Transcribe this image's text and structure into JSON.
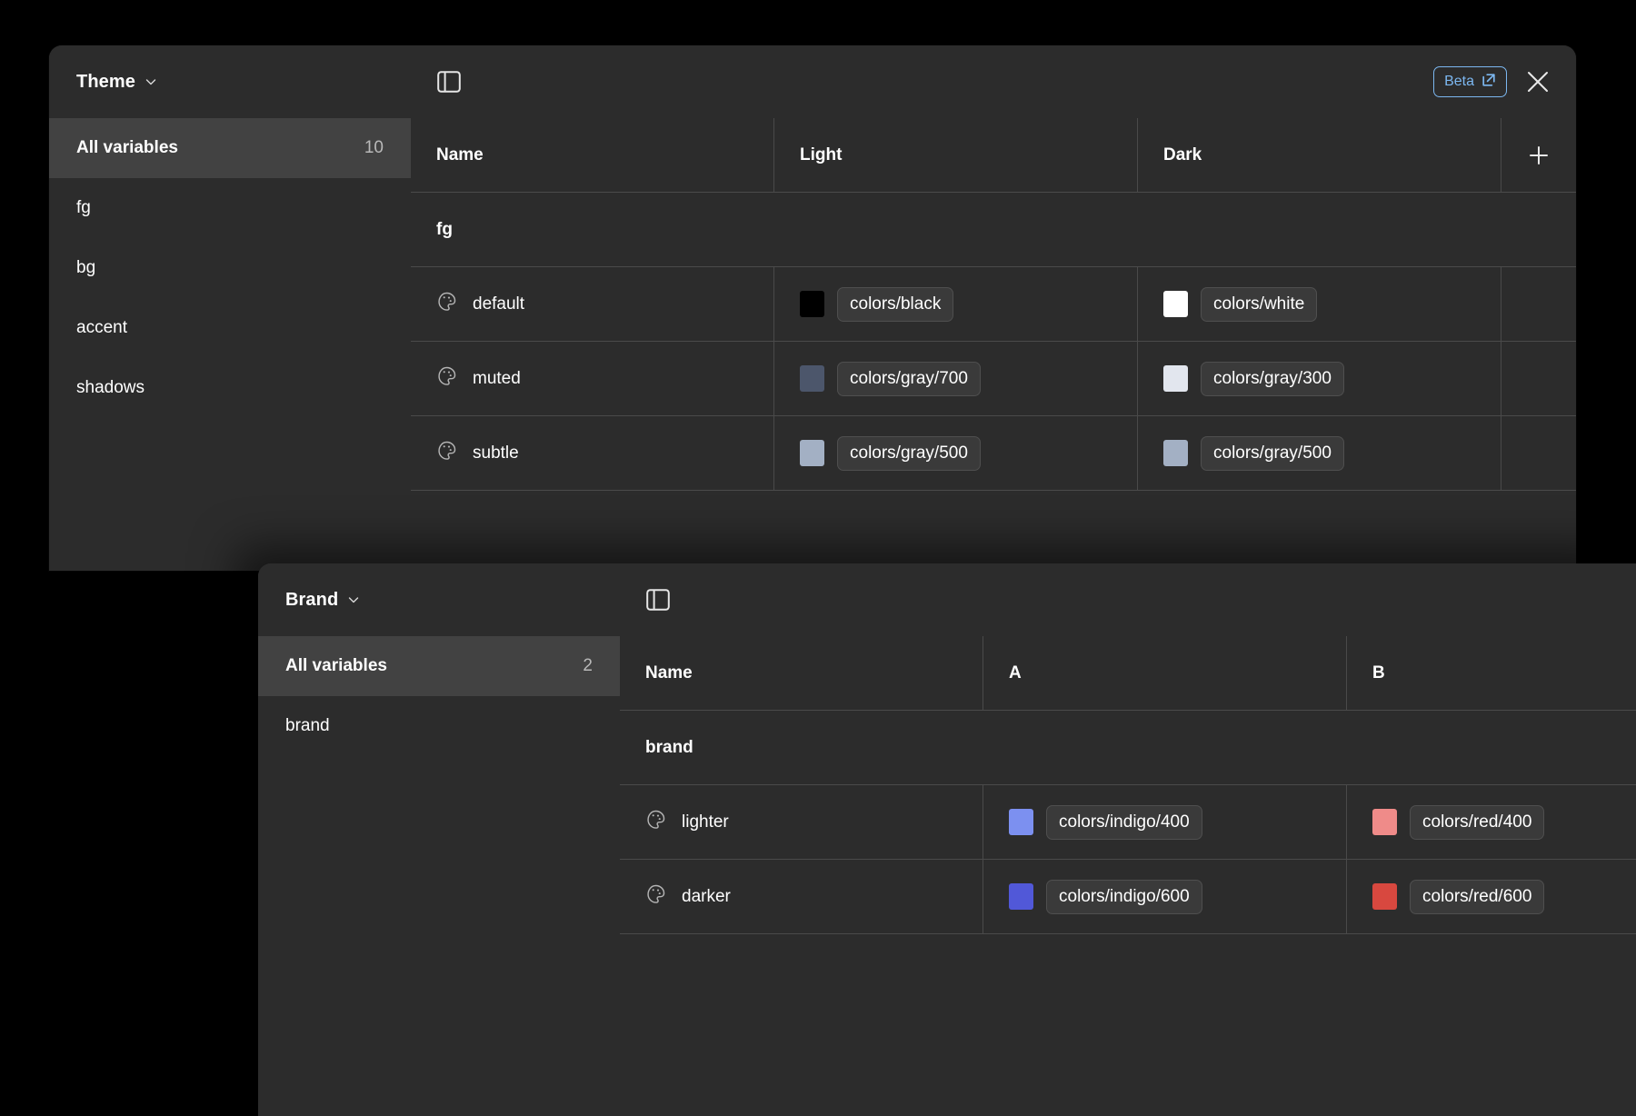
{
  "panels": [
    {
      "id": "theme",
      "collection_name": "Theme",
      "chevron_icon": "chevron-down-icon",
      "panel_toggle_icon": "panel-layout-icon",
      "beta_label": "Beta",
      "beta_external_icon": "external-link-icon",
      "close_icon": "close-icon",
      "add_icon": "plus-icon",
      "sidebar": {
        "all_label": "All variables",
        "all_count": "10",
        "groups": [
          {
            "label": "fg"
          },
          {
            "label": "bg"
          },
          {
            "label": "accent"
          },
          {
            "label": "shadows"
          }
        ]
      },
      "columns": [
        {
          "key": "name",
          "label": "Name"
        },
        {
          "key": "light",
          "label": "Light"
        },
        {
          "key": "dark",
          "label": "Dark"
        }
      ],
      "group_header": "fg",
      "rows": [
        {
          "icon": "color-palette-icon",
          "name": "default",
          "light": {
            "swatch": "#000000",
            "alias": "colors/black"
          },
          "dark": {
            "swatch": "#ffffff",
            "alias": "colors/white"
          }
        },
        {
          "icon": "color-palette-icon",
          "name": "muted",
          "light": {
            "swatch": "#4c566b",
            "alias": "colors/gray/700"
          },
          "dark": {
            "swatch": "#e2e6ee",
            "alias": "colors/gray/300"
          }
        },
        {
          "icon": "color-palette-icon",
          "name": "subtle",
          "light": {
            "swatch": "#a3b0c4",
            "alias": "colors/gray/500"
          },
          "dark": {
            "swatch": "#a3b0c4",
            "alias": "colors/gray/500"
          }
        }
      ]
    },
    {
      "id": "brand",
      "collection_name": "Brand",
      "chevron_icon": "chevron-down-icon",
      "panel_toggle_icon": "panel-layout-icon",
      "sidebar": {
        "all_label": "All variables",
        "all_count": "2",
        "groups": [
          {
            "label": "brand"
          }
        ]
      },
      "columns": [
        {
          "key": "name",
          "label": "Name"
        },
        {
          "key": "a",
          "label": "A"
        },
        {
          "key": "b",
          "label": "B"
        }
      ],
      "group_header": "brand",
      "rows": [
        {
          "icon": "color-palette-icon",
          "name": "lighter",
          "a": {
            "swatch": "#7c90f0",
            "alias": "colors/indigo/400"
          },
          "b": {
            "swatch": "#ef8b89",
            "alias": "colors/red/400"
          }
        },
        {
          "icon": "color-palette-icon",
          "name": "darker",
          "a": {
            "swatch": "#5158d8",
            "alias": "colors/indigo/600"
          },
          "b": {
            "swatch": "#d8483f",
            "alias": "colors/red/600"
          }
        }
      ]
    }
  ],
  "theme_colors": {
    "panel_bg": "#2c2c2c",
    "row_border": "#4a4a4a",
    "selected_row_bg": "#424242",
    "chip_bg": "#3a3a3a",
    "accent_blue": "#7cb7f0",
    "text": "#ffffff",
    "muted_text": "#b9b9b9",
    "canvas": "#000000"
  }
}
